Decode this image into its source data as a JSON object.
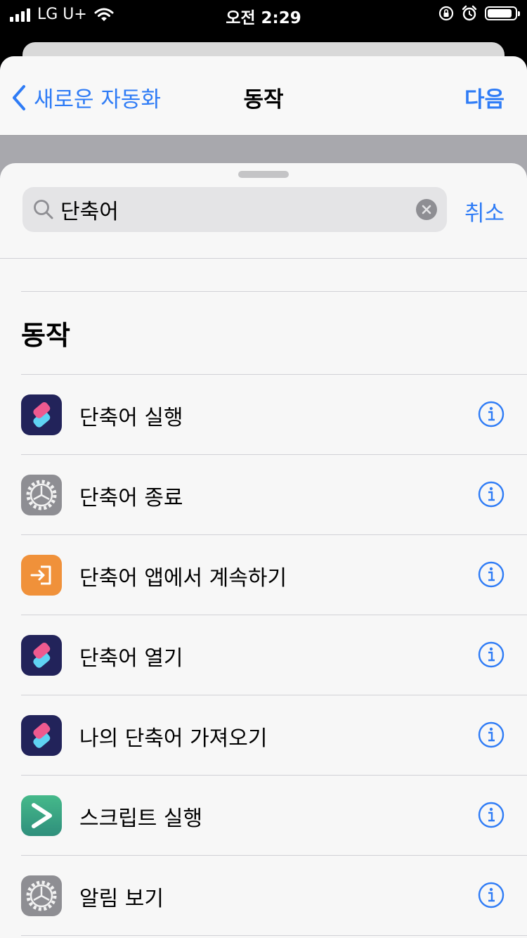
{
  "status_bar": {
    "carrier": "LG U+",
    "time": "오전 2:29",
    "battery_level": 0.9
  },
  "nav": {
    "back_label": "새로운 자동화",
    "title": "동작",
    "next_label": "다음"
  },
  "search": {
    "query": "단축어",
    "cancel_label": "취소"
  },
  "section_title": "동작",
  "colors": {
    "accent": "#2f7cf6",
    "sheet_bg": "#f7f7f7"
  },
  "actions": [
    {
      "label": "단축어 실행",
      "icon": "shortcuts-icon"
    },
    {
      "label": "단축어 종료",
      "icon": "settings-gear-icon"
    },
    {
      "label": "단축어 앱에서 계속하기",
      "icon": "continue-in-app-icon"
    },
    {
      "label": "단축어 열기",
      "icon": "shortcuts-icon"
    },
    {
      "label": "나의 단축어 가져오기",
      "icon": "shortcuts-icon"
    },
    {
      "label": "스크립트 실행",
      "icon": "scripting-icon"
    },
    {
      "label": "알림 보기",
      "icon": "settings-gear-icon"
    }
  ]
}
